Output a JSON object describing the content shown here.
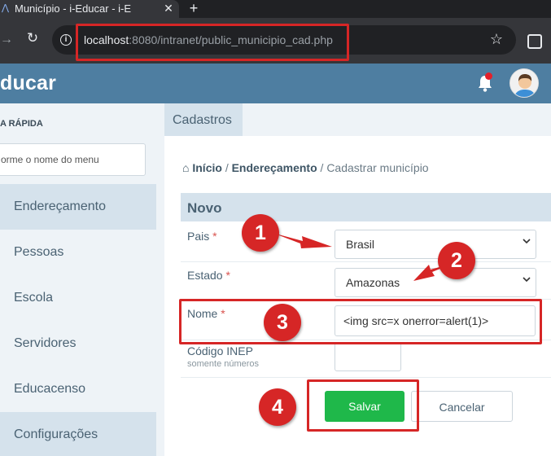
{
  "browser": {
    "tab_title": "Município - i-Educar - i-E",
    "tab_close": "✕",
    "new_tab": "+",
    "url_host": "localhost",
    "url_path": ":8080/intranet/public_municipio_cad.php"
  },
  "header": {
    "brand": "ducar"
  },
  "sidebar": {
    "quick_title": "A RÁPIDA",
    "search_placeholder": "orme o nome do menu",
    "items": [
      {
        "label": "Endereçamento"
      },
      {
        "label": "Pessoas"
      },
      {
        "label": "Escola"
      },
      {
        "label": "Servidores"
      },
      {
        "label": "Educacenso"
      },
      {
        "label": "Configurações"
      }
    ]
  },
  "main": {
    "tab": "Cadastros",
    "breadcrumb": {
      "home": "Início",
      "sep": "/",
      "section": "Endereçamento",
      "current": "Cadastrar município"
    },
    "form_title": "Novo",
    "fields": {
      "pais_label": "Pais",
      "pais_value": "Brasil",
      "estado_label": "Estado",
      "estado_value": "Amazonas",
      "nome_label": "Nome",
      "nome_value": "<img src=x onerror=alert(1)>",
      "inep_label": "Código INEP",
      "inep_hint": "somente números",
      "required_mark": "*"
    },
    "save_label": "Salvar",
    "cancel_label": "Cancelar"
  },
  "annotations": {
    "badges": [
      "1",
      "2",
      "3",
      "4"
    ],
    "accent": "#d62626"
  },
  "colors": {
    "header": "#4e7ea1",
    "save_button": "#1fb84a",
    "sidebar_bg": "#eef3f7",
    "active_bg": "#d5e2ec"
  }
}
